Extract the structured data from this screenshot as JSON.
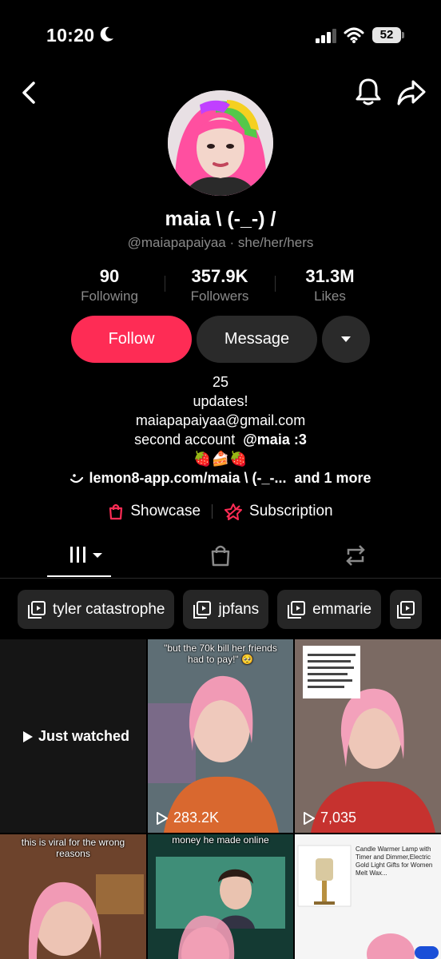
{
  "status": {
    "time": "10:20",
    "battery": "52"
  },
  "profile": {
    "display_name": "maia \\ (-_-) /",
    "handle": "@maiapapaiyaa",
    "pronouns": "she/her/hers",
    "handle_sep": "·"
  },
  "stats": [
    {
      "value": "90",
      "label": "Following"
    },
    {
      "value": "357.9K",
      "label": "Followers"
    },
    {
      "value": "31.3M",
      "label": "Likes"
    }
  ],
  "actions": {
    "follow": "Follow",
    "message": "Message"
  },
  "bio": {
    "line1": "25",
    "line2": "updates!",
    "line3": "maiapapaiyaa@gmail.com",
    "line4_text": "second account",
    "line4_mention": "@maia :3",
    "line5": "🍓🍰🍓"
  },
  "link": {
    "url": "lemon8-app.com/maia \\ (-_-...",
    "more": "and 1 more"
  },
  "shop": {
    "showcase": "Showcase",
    "subscription": "Subscription"
  },
  "playlists": [
    "tyler catastrophe",
    "jpfans",
    "emmarie"
  ],
  "videos": [
    {
      "overlay": "Just watched"
    },
    {
      "views": "283.2K",
      "caption": "\"but the 70k bill her friends had to pay!\" 🥺"
    },
    {
      "views": "7,035"
    },
    {
      "caption": "this is viral for the wrong reasons"
    },
    {
      "caption": "money he made online"
    },
    {
      "caption": "Candle Warmer Lamp with Timer and Dimmer,Electric Gold Light Gifts for Women Melt Wax..."
    }
  ],
  "colors": {
    "accent": "#fe2c55",
    "bg": "#000000",
    "chip": "#262626",
    "muted": "#8a8a8a"
  }
}
